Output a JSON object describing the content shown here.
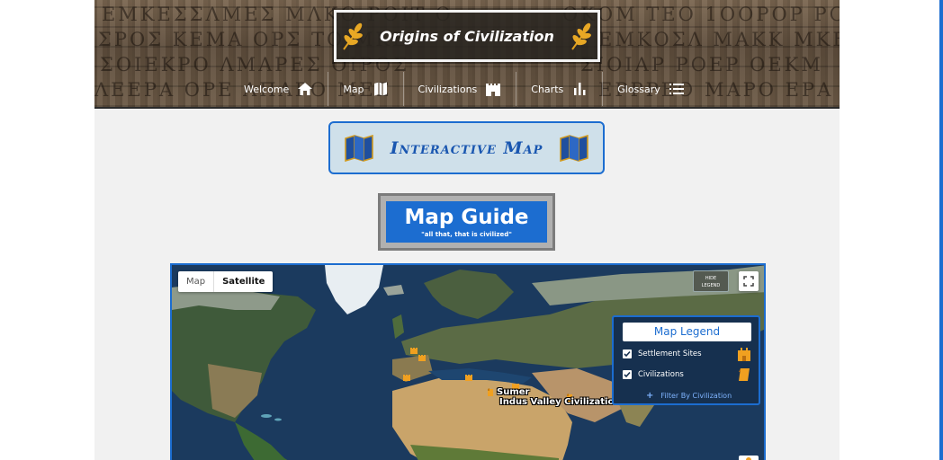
{
  "site": {
    "title": "Origins of Civilization"
  },
  "nav": {
    "items": [
      {
        "label": "Welcome",
        "icon": "home-icon"
      },
      {
        "label": "Map",
        "icon": "map-icon"
      },
      {
        "label": "Civilizations",
        "icon": "castle-icon"
      },
      {
        "label": "Charts",
        "icon": "bar-chart-icon"
      },
      {
        "label": "Glossary",
        "icon": "list-icon"
      }
    ]
  },
  "banner": {
    "title": "Interactive Map"
  },
  "guide": {
    "title": "Map Guide",
    "subtitle": "\"all that, that is civilized\""
  },
  "map": {
    "type_buttons": [
      "Map",
      "Satellite"
    ],
    "active_type": "Satellite",
    "hide_legend": [
      "HIDE",
      "LEGEND"
    ],
    "labels": [
      "Sumer",
      "Indus Valley Civilization"
    ],
    "legend": {
      "title": "Map Legend",
      "rows": [
        {
          "label": "Settlement Sites",
          "checked": true,
          "icon": "castle-icon"
        },
        {
          "label": "Civilizations",
          "checked": true,
          "icon": "scroll-icon"
        }
      ],
      "filter_label": "Filter By Civilization"
    }
  },
  "colors": {
    "accent": "#1c6dd0",
    "legend_bg": "#16304f",
    "banner_bg": "#cfe0ea",
    "marker": "#f0a020"
  }
}
